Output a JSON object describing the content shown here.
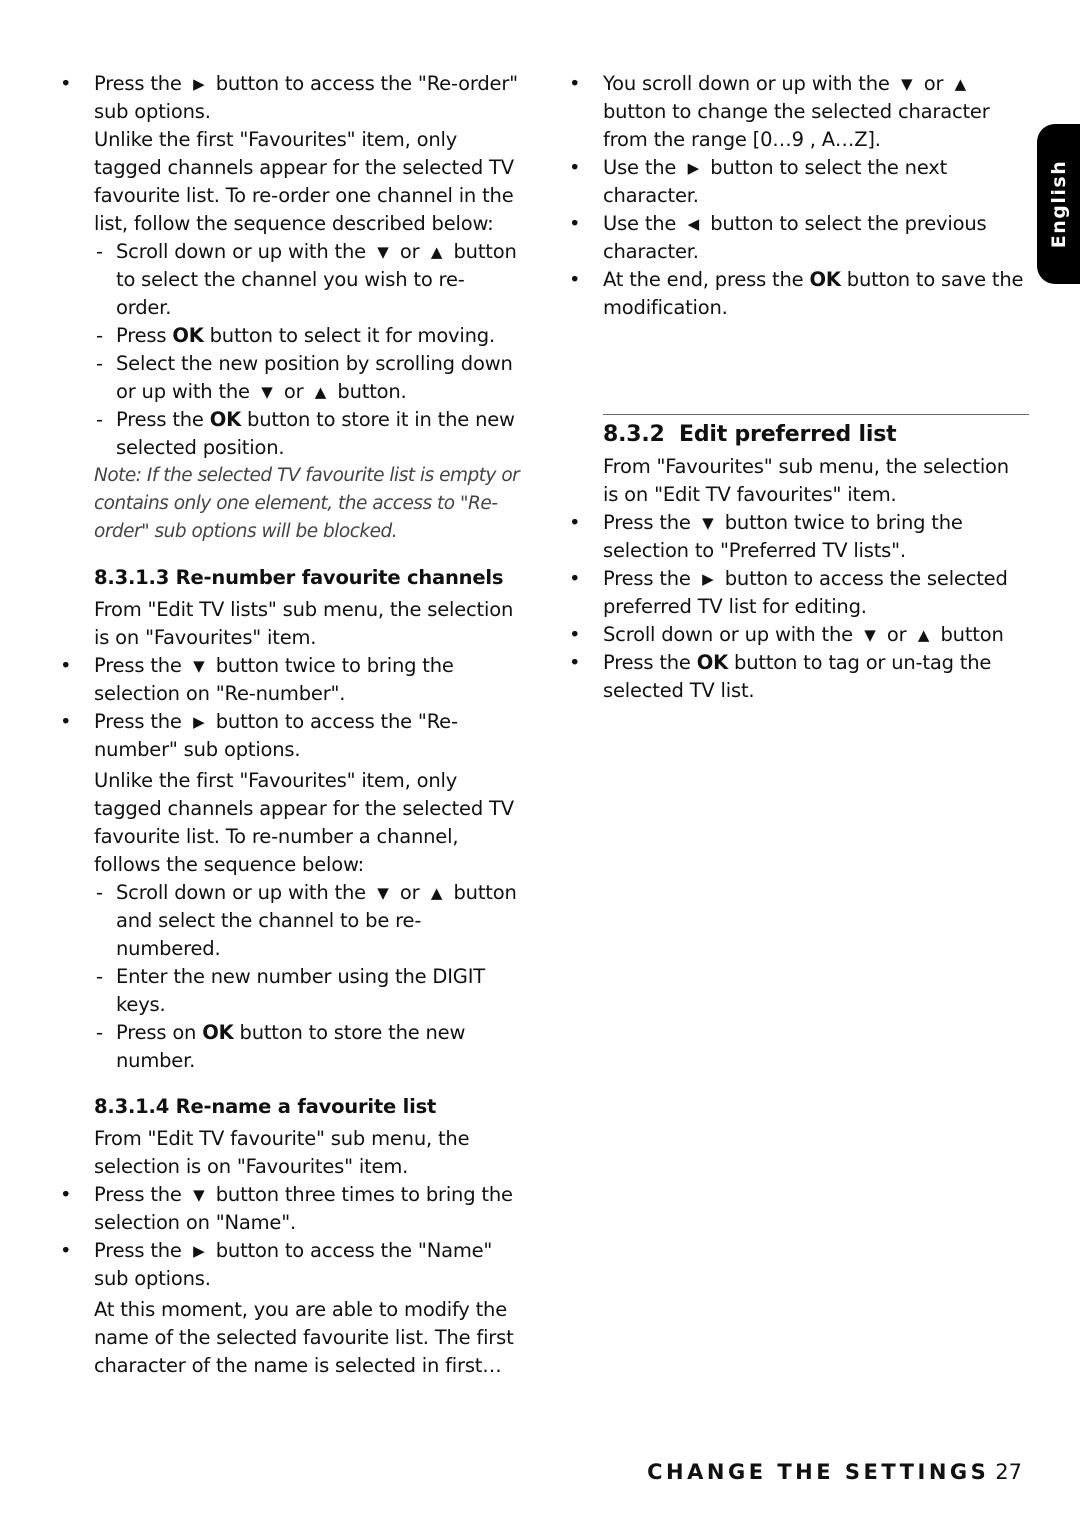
{
  "language_tab": "English",
  "footer": {
    "section_title": "CHANGE THE SETTINGS",
    "page_number": "27"
  },
  "icons": {
    "right": "▶",
    "left": "◀",
    "down": "▼",
    "up": "▲"
  },
  "left": {
    "b1": {
      "a": "Press the",
      "b": "button to access the \"Re-order\" sub options."
    },
    "p1": "Unlike the first \"Favourites\" item, only tagged channels appear for the selected TV favourite list. To re-order one channel in the list, follow the sequence described below:",
    "d1": {
      "a": "Scroll down or up with the",
      "or": "or",
      "b": "button to select the channel you wish to re-order."
    },
    "d2": {
      "a": "Press",
      "ok": "OK",
      "b": "button to select it for moving."
    },
    "d3": {
      "a": "Select the new position by scrolling down or up with the",
      "or": "or",
      "b": "button."
    },
    "d4": {
      "a": "Press the",
      "ok": "OK",
      "b": "button to store it in the new selected position."
    },
    "note": "Note: If the selected TV favourite list is empty or contains only one element, the access to \"Re-order\" sub options will be blocked.",
    "h_renumber": "8.3.1.3 Re-number favourite channels",
    "p2": "From \"Edit TV lists\" sub menu, the selection is on \"Favourites\" item.",
    "b2": {
      "a": "Press the",
      "b": "button twice to bring the selection on \"Re-number\"."
    },
    "b3": {
      "a": "Press the",
      "b": "button to access the \"Re-number\" sub options."
    },
    "p3": "Unlike the first \"Favourites\" item, only tagged channels appear for the selected TV favourite list. To re-number a channel, follows the sequence below:",
    "d5": {
      "a": "Scroll down or up with the",
      "or": "or",
      "b": "button and select the channel to be re-numbered."
    },
    "d6": "Enter the new number using the DIGIT keys.",
    "d7": {
      "a": "Press on",
      "ok": "OK",
      "b": "button to store the new number."
    },
    "h_rename": "8.3.1.4 Re-name a favourite list",
    "p4": "From \"Edit TV favourite\" sub menu, the selection is on \"Favourites\" item.",
    "b4": {
      "a": "Press the",
      "b": "button three times to bring the selection on \"Name\"."
    },
    "b5": {
      "a": "Press the",
      "b": "button to access the \"Name\" sub options."
    },
    "p5": "At this moment, you are able to modify the name of the selected favourite list. The first character of the name is selected in first…"
  },
  "right": {
    "b1": {
      "a": "You scroll down or up with the",
      "or": "or",
      "b": "button to change the selected character from the range  [0…9 , A…Z]."
    },
    "b2": {
      "a": "Use the",
      "b": "button to select the next character."
    },
    "b3": {
      "a": "Use the",
      "b": "button to select the previous character."
    },
    "b4": {
      "a": "At the end, press the",
      "ok": "OK",
      "b": "button to save the modification."
    },
    "h_num": "8.3.2",
    "h_title": "Edit preferred list",
    "p1": "From \"Favourites\" sub menu, the selection is on \"Edit TV favourites\" item.",
    "b5": {
      "a": "Press the",
      "b": "button twice to bring the selection to \"Preferred TV lists\"."
    },
    "b6": {
      "a": "Press the",
      "b": "button to access the selected preferred TV list for editing."
    },
    "b7": {
      "a": "Scroll down or up with the",
      "or": "or",
      "b": "button"
    },
    "b8": {
      "a": "Press the",
      "ok": "OK",
      "b": "button to tag or un-tag the selected TV list."
    }
  }
}
